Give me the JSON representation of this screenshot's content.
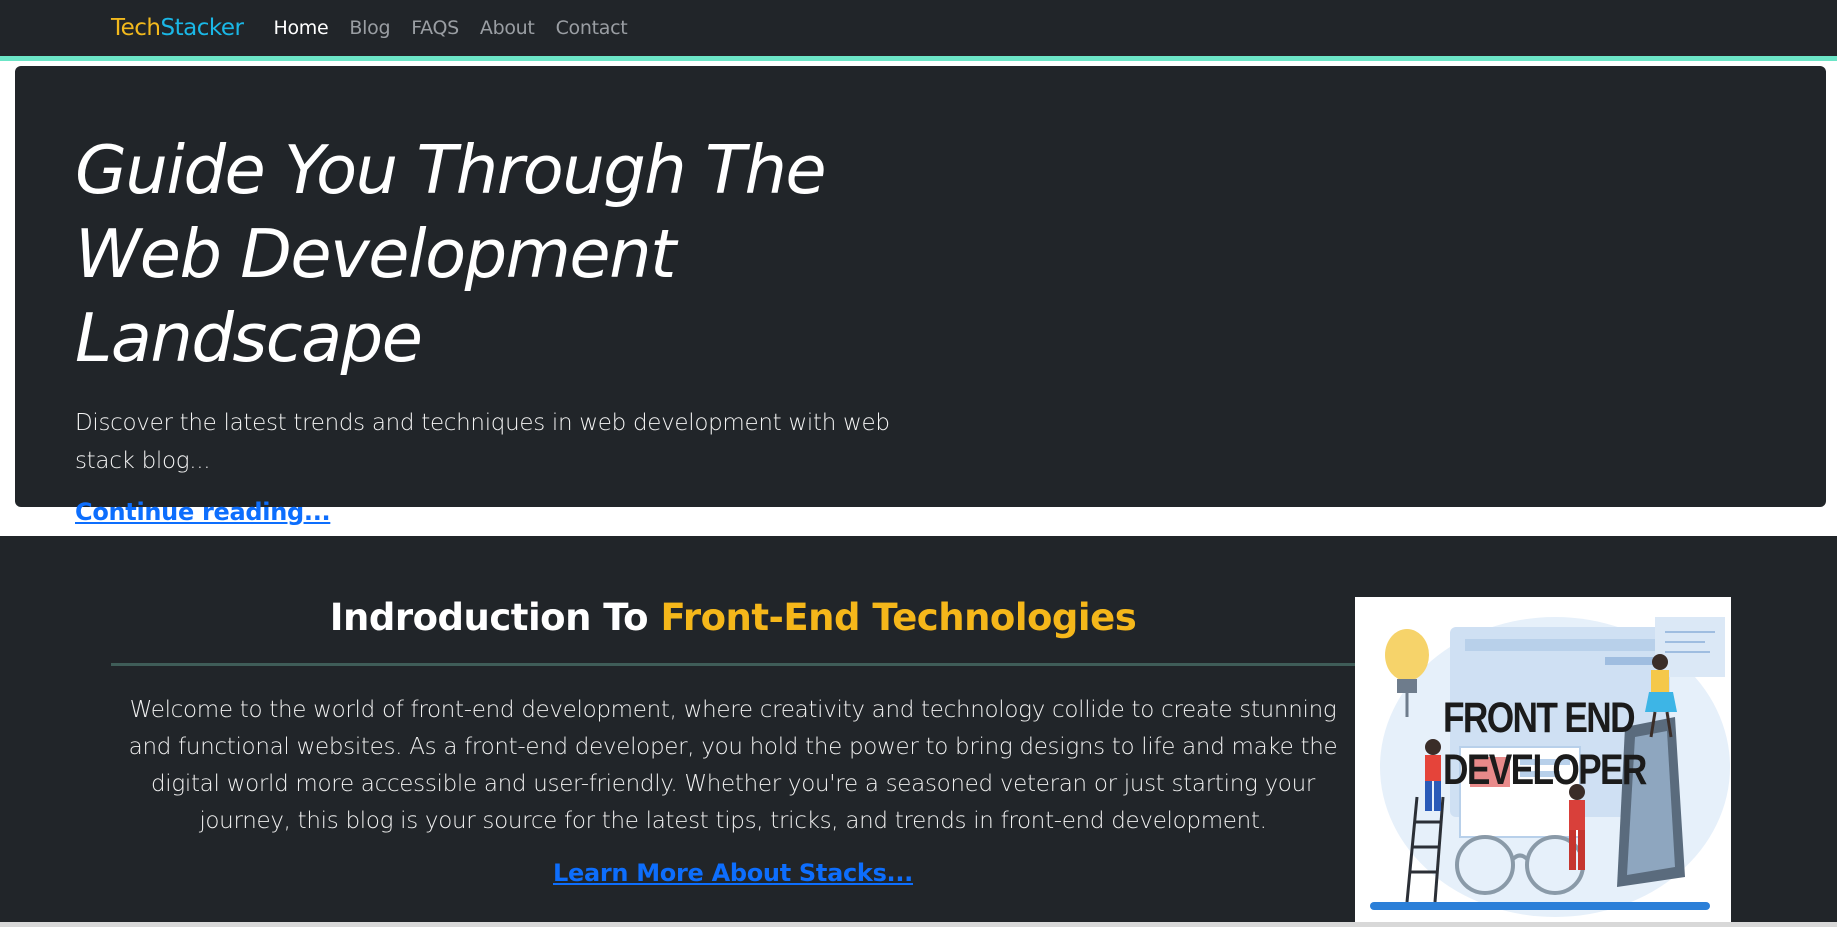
{
  "nav": {
    "brand_part1": "Tech",
    "brand_part2": "Stacker",
    "links": [
      "Home",
      "Blog",
      "FAQS",
      "About",
      "Contact"
    ],
    "active": "Home"
  },
  "hero": {
    "title": "Guide You Through The Web Development Landscape",
    "lead": "Discover the latest trends and techniques in web development with web stack blog...",
    "link_label": "Continue reading..."
  },
  "intro": {
    "title_plain": "Indroduction To",
    "title_highlight": "Front-End Technologies",
    "body": "Welcome to the world of front-end development, where creativity and technology collide to create stunning and functional websites. As a front-end developer, you hold the power to bring designs to life and make the digital world more accessible and user-friendly. Whether you're a seasoned veteran or just starting your journey, this blog is your source for the latest tips, tricks, and trends in front-end development.",
    "link_label": "Learn More About Stacks...",
    "image": {
      "caption_line1": "FRONT END",
      "caption_line2": "DEVELOPER",
      "icon": "front-end-developer-illustration"
    }
  },
  "colors": {
    "navbar_bg": "#212529",
    "navbar_accent": "#6be5c6",
    "brand_yellow": "#f2b91d",
    "brand_blue": "#1ab7e6",
    "highlight": "#f5b71a",
    "link": "#0d6efd"
  }
}
